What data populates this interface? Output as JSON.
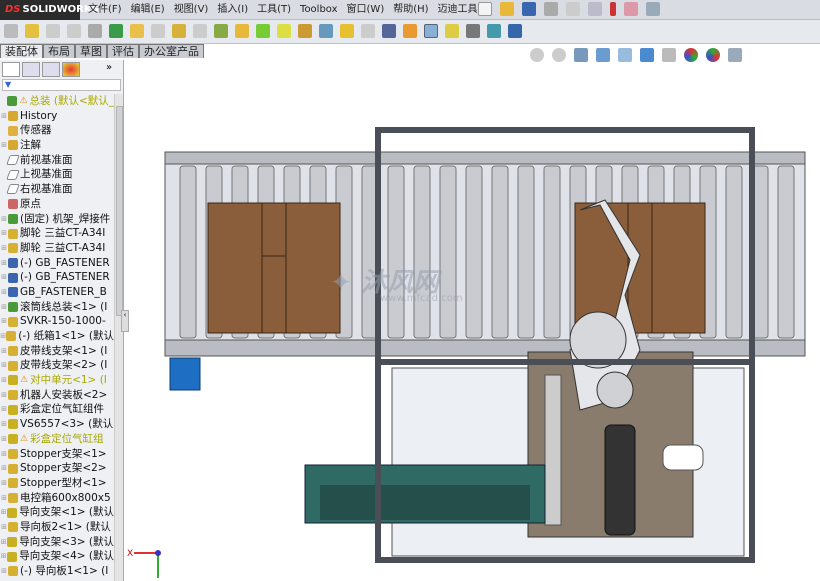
{
  "app": {
    "logo": "SOLIDWORKS",
    "logo_prefix": "DS"
  },
  "menu": [
    "文件(F)",
    "编辑(E)",
    "视图(V)",
    "插入(I)",
    "工具(T)",
    "Toolbox",
    "窗口(W)",
    "帮助(H)",
    "迈迪工具集"
  ],
  "tabs": [
    "装配体",
    "布局",
    "草图",
    "评估",
    "办公室产品"
  ],
  "panel": {
    "more": "»",
    "filter": "▼"
  },
  "tree": [
    {
      "label": "总装 (默认<默认_",
      "icon": "assembly",
      "warn": true
    },
    {
      "label": "History",
      "icon": "history"
    },
    {
      "label": "传感器",
      "icon": "sensor"
    },
    {
      "label": "注解",
      "icon": "annotation"
    },
    {
      "label": "前视基准面",
      "icon": "plane"
    },
    {
      "label": "上视基准面",
      "icon": "plane"
    },
    {
      "label": "右视基准面",
      "icon": "plane"
    },
    {
      "label": "原点",
      "icon": "origin"
    },
    {
      "label": "(固定) 机架_焊接件",
      "icon": "assembly"
    },
    {
      "label": "脚轮 三益CT-A34I",
      "icon": "part"
    },
    {
      "label": "脚轮 三益CT-A34I",
      "icon": "part"
    },
    {
      "label": "(-) GB_FASTENER",
      "icon": "fastener"
    },
    {
      "label": "(-) GB_FASTENER",
      "icon": "fastener"
    },
    {
      "label": "GB_FASTENER_B",
      "icon": "fastener"
    },
    {
      "label": "滚筒线总装<1> (I",
      "icon": "assembly"
    },
    {
      "label": "SVKR-150-1000-",
      "icon": "part"
    },
    {
      "label": "(-) 纸箱1<1> (默认",
      "icon": "part"
    },
    {
      "label": "皮带线支架<1> (I",
      "icon": "part"
    },
    {
      "label": "皮带线支架<2> (I",
      "icon": "part"
    },
    {
      "label": "对中单元<1> (I",
      "icon": "subasm",
      "warn": true
    },
    {
      "label": "机器人安装板<2>",
      "icon": "part"
    },
    {
      "label": "彩盒定位气缸组件",
      "icon": "subasm"
    },
    {
      "label": "VS6557<3> (默认",
      "icon": "subasm"
    },
    {
      "label": "彩盒定位气缸组",
      "icon": "subasm",
      "warn": true
    },
    {
      "label": "Stopper支架<1>",
      "icon": "part"
    },
    {
      "label": "Stopper支架<2>",
      "icon": "part"
    },
    {
      "label": "Stopper型材<1>",
      "icon": "part"
    },
    {
      "label": "电控箱600x800x5",
      "icon": "part"
    },
    {
      "label": "导向支架<1> (默认",
      "icon": "subasm"
    },
    {
      "label": "导向板2<1> (默认",
      "icon": "part"
    },
    {
      "label": "导向支架<3> (默认",
      "icon": "subasm"
    },
    {
      "label": "导向支架<4> (默认",
      "icon": "subasm"
    },
    {
      "label": "(-) 导向板1<1> (I",
      "icon": "part"
    }
  ],
  "triad": {
    "x": "X"
  },
  "watermark": {
    "cn": "沐风网",
    "url": "www.mfcad.com"
  },
  "colors": {
    "box": "#8a5e3a",
    "roller": "#c9cbd0",
    "frame": "#4a4e57",
    "belt": "#2f6a64",
    "plate": "#8a7c6c"
  }
}
